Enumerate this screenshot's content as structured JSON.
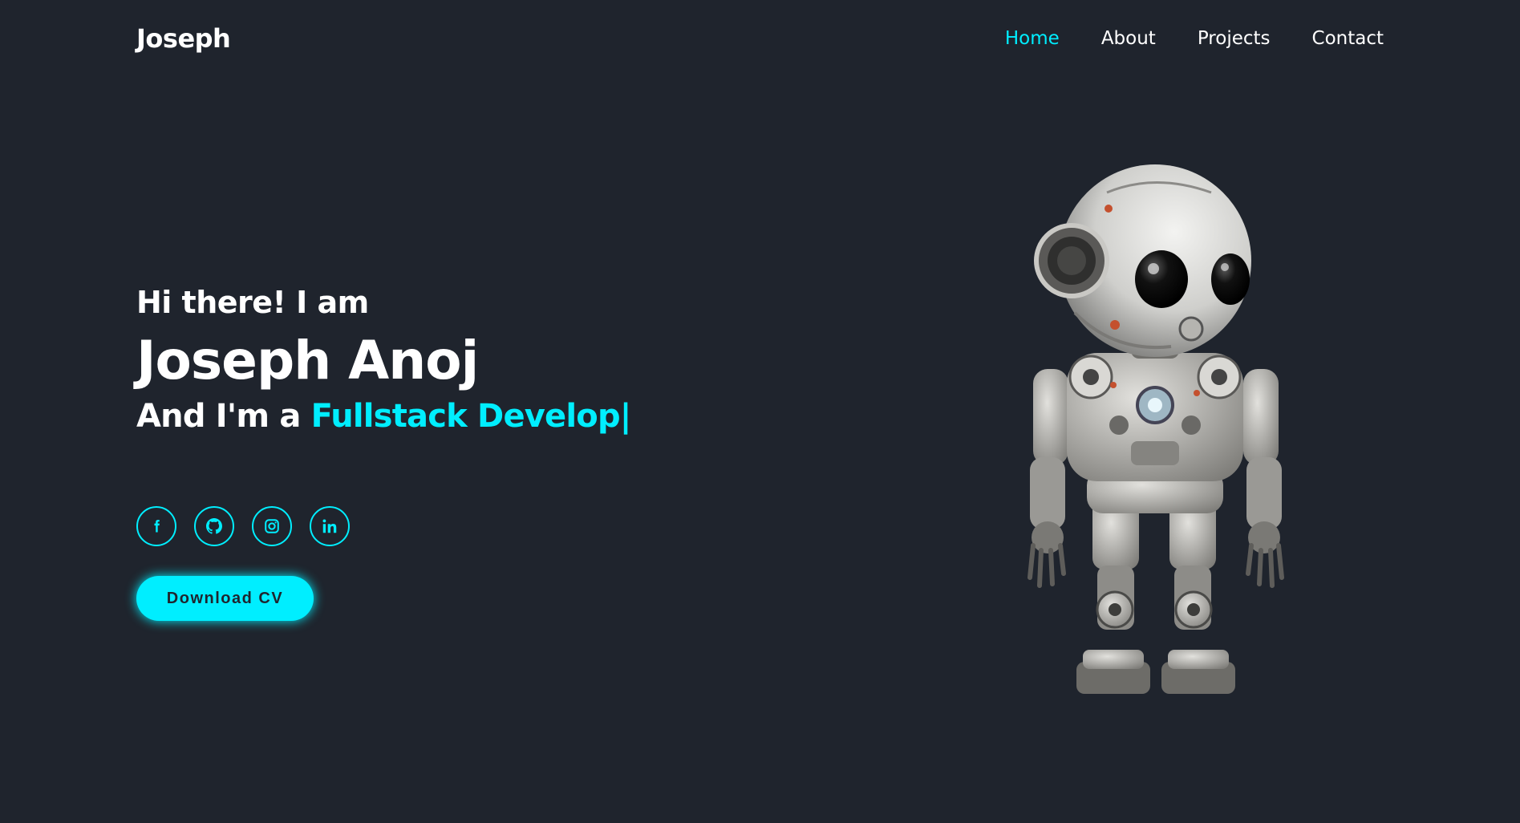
{
  "header": {
    "logo": "Joseph",
    "nav": [
      {
        "label": "Home",
        "active": true
      },
      {
        "label": "About",
        "active": false
      },
      {
        "label": "Projects",
        "active": false
      },
      {
        "label": "Contact",
        "active": false
      }
    ]
  },
  "hero": {
    "greeting": "Hi there! I am",
    "name": "Joseph Anoj",
    "role_prefix": "And I'm a ",
    "role_typed": "Fullstack Develop|",
    "download_label": "Download CV"
  },
  "social": [
    {
      "icon": "facebook-icon"
    },
    {
      "icon": "github-icon"
    },
    {
      "icon": "instagram-icon"
    },
    {
      "icon": "linkedin-icon"
    }
  ],
  "colors": {
    "background": "#1f242d",
    "accent": "#00eeff",
    "text": "#ffffff"
  }
}
